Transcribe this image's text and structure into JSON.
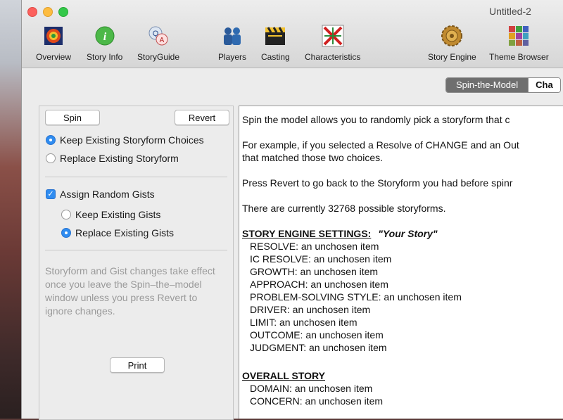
{
  "window": {
    "title": "Untitled-2"
  },
  "toolbar": [
    {
      "label": "Overview",
      "icon": "overview-icon"
    },
    {
      "label": "Story Info",
      "icon": "info-icon"
    },
    {
      "label": "StoryGuide",
      "icon": "storyguide-icon"
    },
    {
      "label": "Players",
      "icon": "players-icon"
    },
    {
      "label": "Casting",
      "icon": "casting-icon"
    },
    {
      "label": "Characteristics",
      "icon": "characteristics-icon"
    },
    {
      "label": "Story Engine",
      "icon": "story-engine-icon"
    },
    {
      "label": "Theme Browser",
      "icon": "theme-browser-icon"
    }
  ],
  "segments": {
    "active": "Spin-the-Model",
    "next": "Cha"
  },
  "left": {
    "spin": "Spin",
    "revert": "Revert",
    "keep_choices": "Keep Existing Storyform Choices",
    "replace_storyform": "Replace Existing Storyform",
    "assign_gists": "Assign Random Gists",
    "keep_gists": "Keep Existing Gists",
    "replace_gists": "Replace Existing Gists",
    "note": "Storyform and Gist changes take effect once you leave the Spin–the–model window unless you press Revert to ignore changes.",
    "print": "Print"
  },
  "doc": {
    "p1": "Spin the model allows you to randomly pick a storyform that c",
    "p2a": "For example, if you selected a Resolve of CHANGE and an Out",
    "p2b": "that matched those two choices.",
    "p3": "Press Revert to go back to the Storyform you had before spinr",
    "p4": "There are currently 32768 possible storyforms.",
    "engine_heading": "STORY ENGINE SETTINGS:",
    "engine_story": "\"Your Story\"",
    "engine_items": [
      "RESOLVE:  an unchosen item",
      "IC RESOLVE:  an unchosen item",
      "GROWTH:  an unchosen item",
      "APPROACH:  an unchosen item",
      "PROBLEM-SOLVING STYLE:  an unchosen item",
      "DRIVER:  an unchosen item",
      "LIMIT:  an unchosen item",
      "OUTCOME:  an unchosen item",
      "JUDGMENT:  an unchosen item"
    ],
    "overall_heading": "OVERALL STORY",
    "overall_items": [
      "DOMAIN:  an unchosen item",
      "CONCERN:  an unchosen item"
    ]
  }
}
